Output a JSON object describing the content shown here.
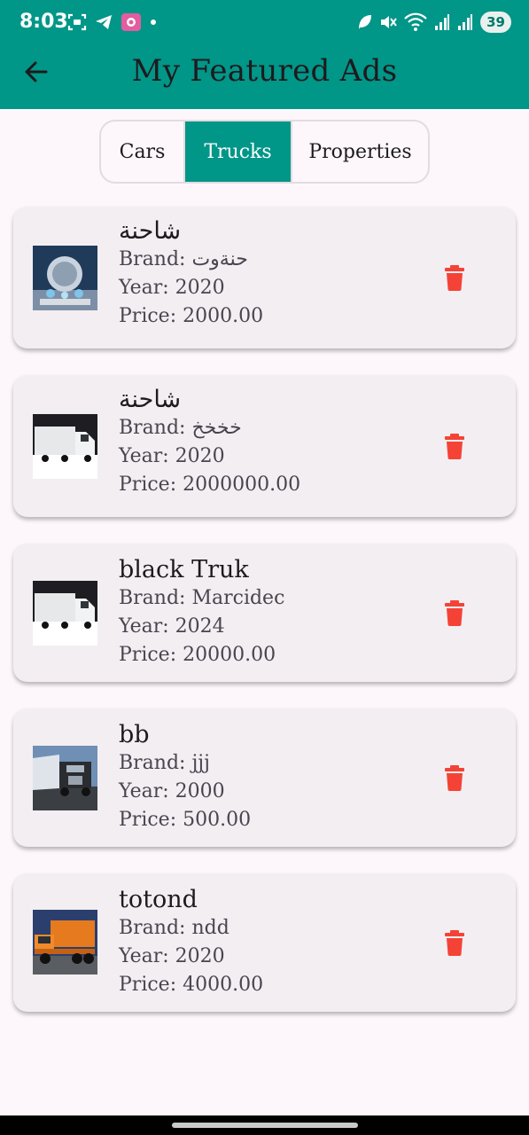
{
  "status_bar": {
    "time": "8:03",
    "battery": "39",
    "icons": [
      "screenshot-icon",
      "telegram-icon",
      "app-icon",
      "dot-icon",
      "leaf-icon",
      "mute-icon",
      "wifi-icon",
      "signal-icon",
      "signal-icon"
    ]
  },
  "header": {
    "title": "My Featured Ads",
    "back_icon": "arrow-left-icon"
  },
  "tabs": [
    {
      "label": "Cars",
      "selected": false
    },
    {
      "label": "Trucks",
      "selected": true
    },
    {
      "label": "Properties",
      "selected": false
    }
  ],
  "ads": [
    {
      "title": "شاحنة",
      "brand": "Brand: حنةوت",
      "year": "Year: 2020",
      "price": "Price: 2000.00",
      "image": "crystal-model-image"
    },
    {
      "title": "شاحنة",
      "brand": "Brand: خخخخ",
      "year": "Year: 2020",
      "price": "Price: 2000000.00",
      "image": "white-truck-image"
    },
    {
      "title": "black Truk",
      "brand": "Brand: Marcidec",
      "year": "Year: 2024",
      "price": "Price: 20000.00",
      "image": "white-truck-image"
    },
    {
      "title": "bb",
      "brand": "Brand: jjj",
      "year": "Year: 2000",
      "price": "Price: 500.00",
      "image": "semi-truck-image"
    },
    {
      "title": "totond",
      "brand": "Brand: ndd",
      "year": "Year: 2020",
      "price": "Price: 4000.00",
      "image": "orange-dump-truck-image"
    }
  ],
  "colors": {
    "primary": "#009688",
    "delete": "#f44336",
    "card": "#f3eef2",
    "background": "#fdf7fc"
  }
}
